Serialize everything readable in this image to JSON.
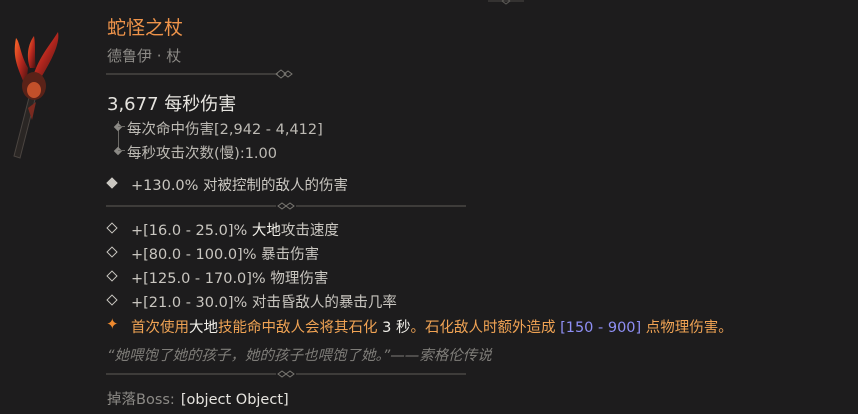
{
  "item": {
    "name": "蛇怪之杖",
    "type_line": "德鲁伊 · 杖",
    "icon": "serpent-staff-icon"
  },
  "damage": {
    "dps_line": "3,677 每秒伤害",
    "per_hit": "每次命中伤害[2,942 - 4,412]",
    "attack_speed": "每秒攻击次数(慢):1.00"
  },
  "implicit": {
    "text": "+130.0% 对被控制的敌人的伤害"
  },
  "affixes": [
    {
      "pre": "+[16.0 - 25.0]% ",
      "hl": "大地",
      "post": "攻击速度"
    },
    {
      "pre": "+[80.0 - 100.0]% 暴击伤害",
      "hl": "",
      "post": ""
    },
    {
      "pre": "+[125.0 - 170.0]% 物理伤害",
      "hl": "",
      "post": ""
    },
    {
      "pre": "+[21.0 - 30.0]% 对击昏敌人的暴击几率",
      "hl": "",
      "post": ""
    }
  ],
  "unique_power": {
    "part1": "首次使用",
    "hl1": "大地",
    "part2": "技能命中敌人会将其石化",
    "hl2": "3 秒",
    "part3": "。石化敌人时额外造成",
    "range": "[150 - 900]",
    "part4": "点物理伤害。"
  },
  "lore": "“她喂饱了她的孩子，她的孩子也喂饱了她。”——索格伦传说",
  "drop": {
    "label": "掉落Boss:",
    "value": "[object Object]"
  },
  "colors": {
    "title": "#f0944a",
    "legendary": "#f0a354",
    "range_blue": "#8f8ff5",
    "background": "#1d1c1d"
  }
}
